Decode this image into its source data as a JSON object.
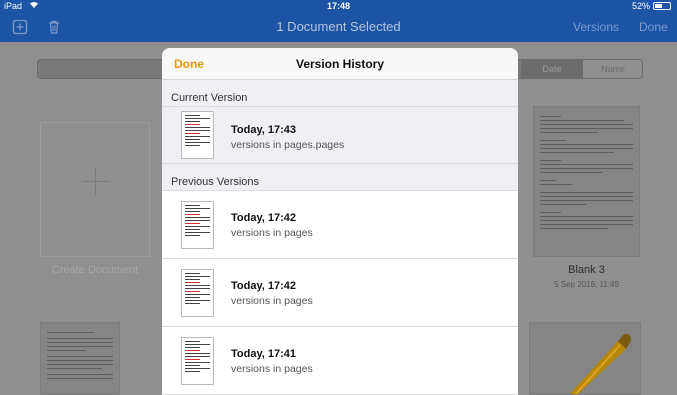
{
  "status_bar": {
    "device": "iPad",
    "time": "17:48",
    "battery": "52%",
    "battery_level": 0.52
  },
  "nav": {
    "title": "1 Document Selected",
    "versions_label": "Versions",
    "done_label": "Done",
    "icons": [
      "add-doc-icon",
      "trash-icon"
    ]
  },
  "background": {
    "sort_date": "Date",
    "sort_name": "Name",
    "create_label": "Create Document",
    "blank_title": "Blank 3",
    "blank_date": "5 Sep 2016, 11:49"
  },
  "modal": {
    "done_label": "Done",
    "title": "Version History",
    "current_header": "Current Version",
    "previous_header": "Previous Versions",
    "current": {
      "title": "Today, 17:43",
      "subtitle": "versions in pages.pages"
    },
    "previous": [
      {
        "title": "Today, 17:42",
        "subtitle": "versions in pages"
      },
      {
        "title": "Today, 17:42",
        "subtitle": "versions in pages"
      },
      {
        "title": "Today, 17:41",
        "subtitle": "versions in pages"
      }
    ]
  },
  "colors": {
    "nav_blue": "#1c54a6",
    "accent_orange": "#f0950f"
  }
}
